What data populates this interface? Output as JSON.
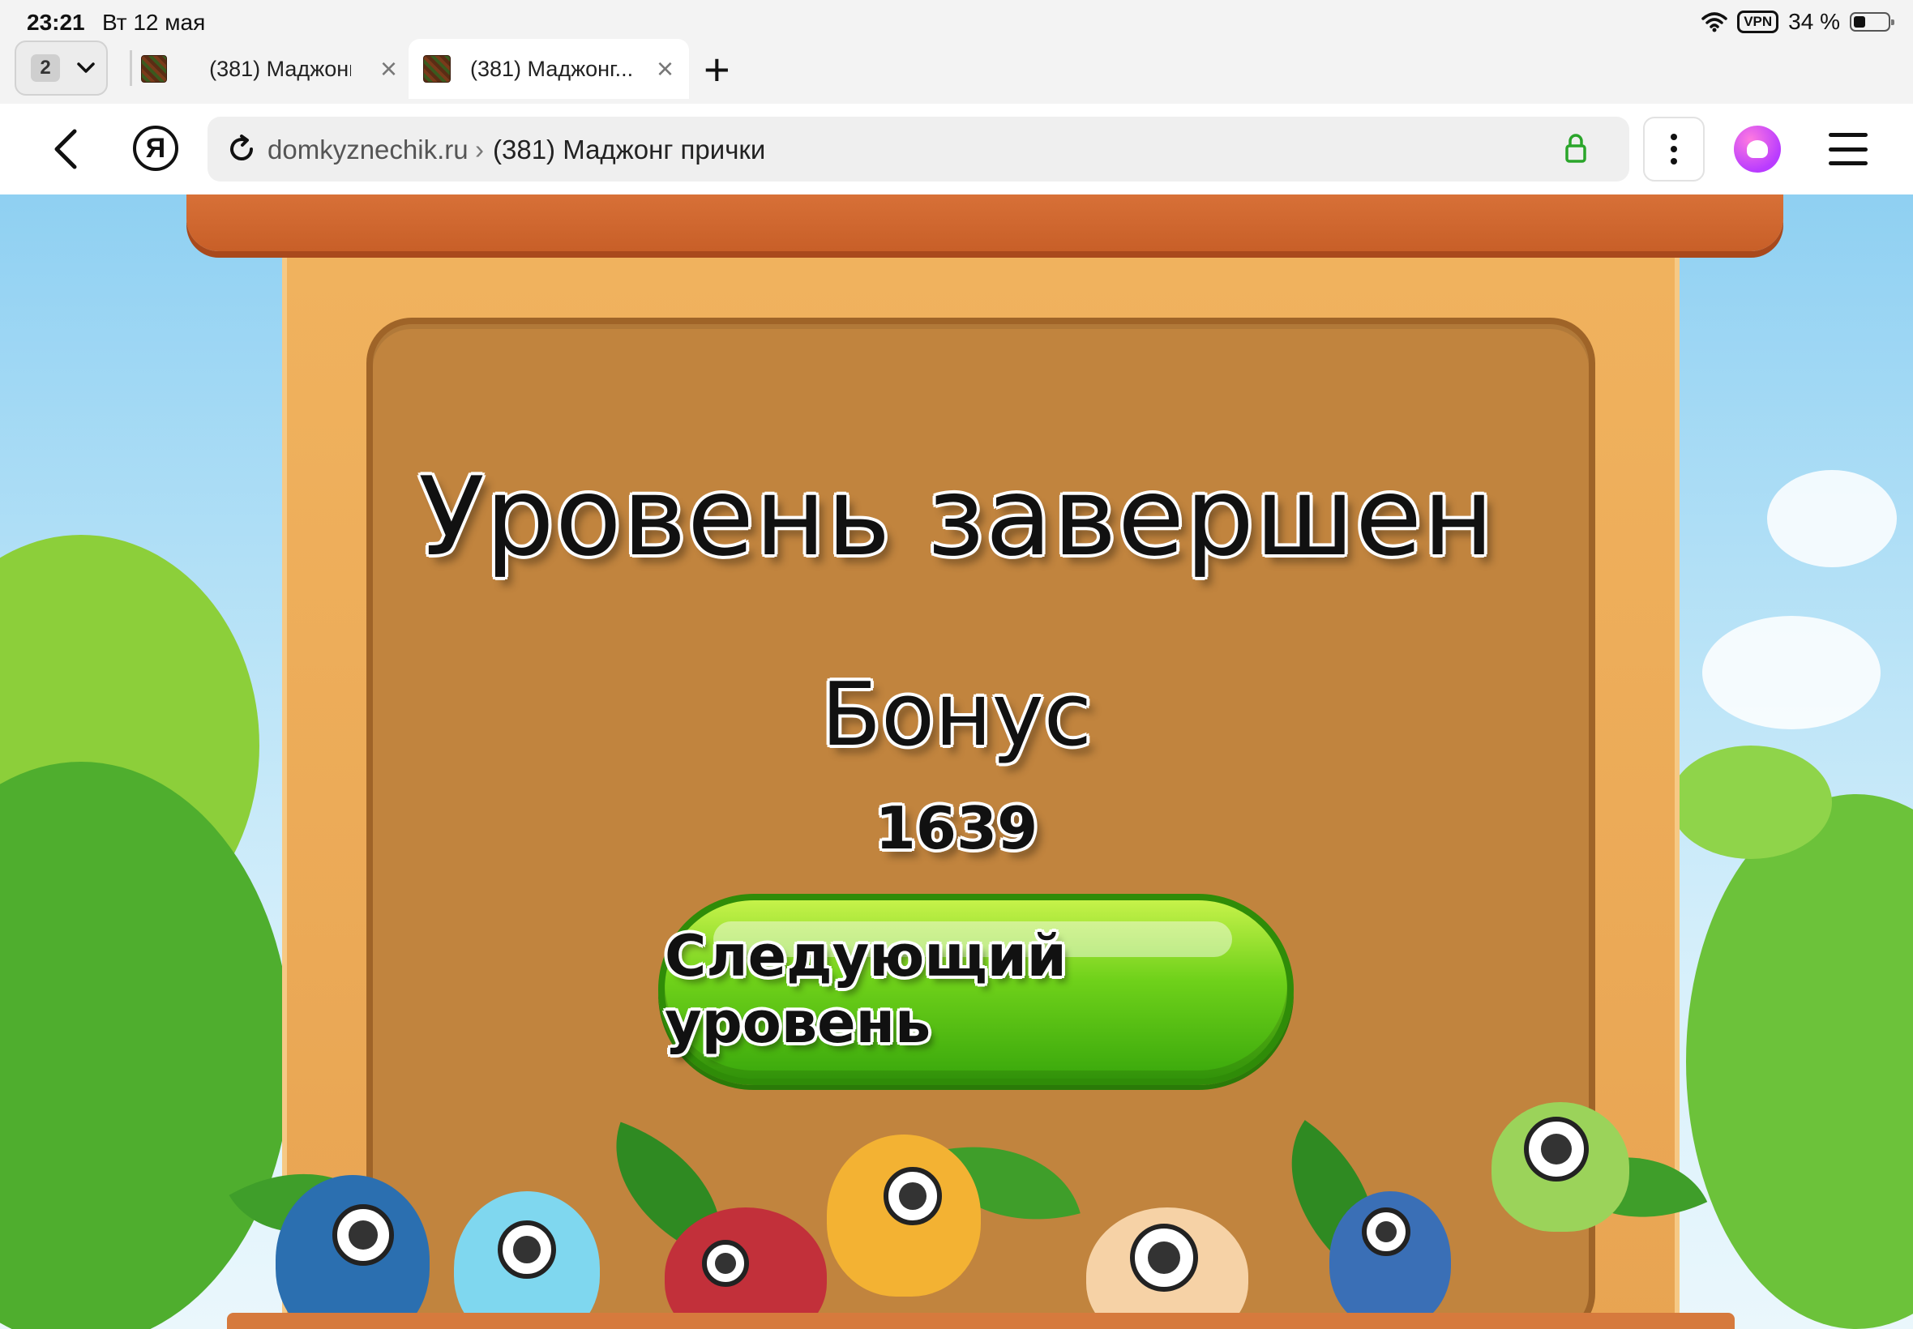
{
  "status_bar": {
    "time": "23:21",
    "date": "Вт 12 мая",
    "vpn_label": "VPN",
    "battery_text": "34 %"
  },
  "tabs": {
    "count": "2",
    "items": [
      {
        "title": "(381) Маджонг",
        "active": false
      },
      {
        "title": "(381) Маджонг...",
        "active": true
      }
    ]
  },
  "address_bar": {
    "yandex_letter": "Я",
    "domain": "domkyznechik.ru",
    "separator": "›",
    "page_title": "(381) Маджонг прички"
  },
  "game": {
    "level_title": "Уровень завершен",
    "bonus_label": "Бонус",
    "bonus_value": "1639",
    "next_button_label": "Следующий уровень"
  },
  "colors": {
    "panel": "#c1843e",
    "board": "#e8a452",
    "button_green": "#6fd11a",
    "sky": "#b9e3f7",
    "lock_green": "#2aa52a"
  }
}
